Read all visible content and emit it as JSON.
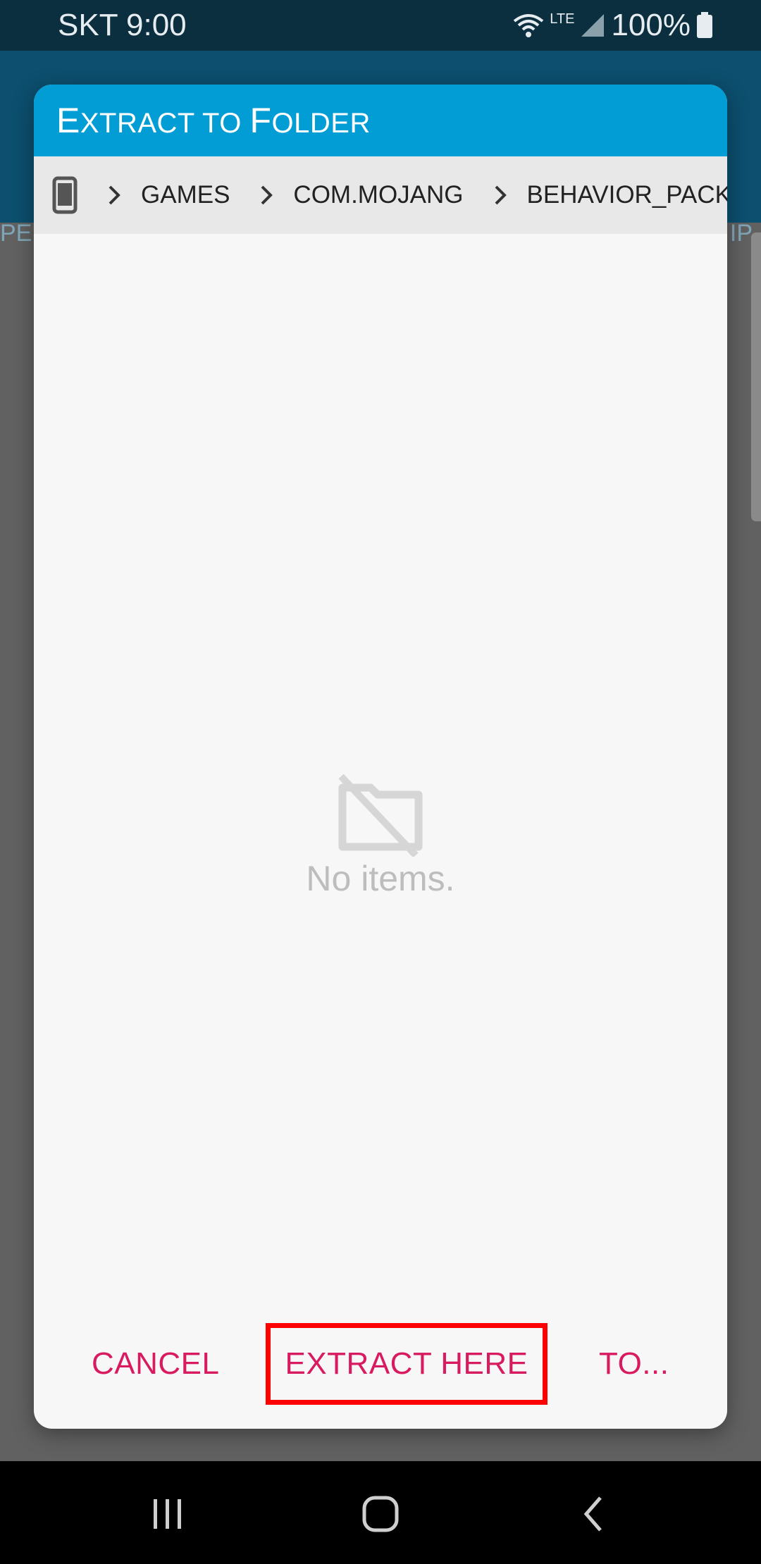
{
  "status_bar": {
    "carrier_time": "SKT 9:00",
    "network": "LTE",
    "battery": "100%"
  },
  "background_app": {
    "left_tab_fragment": "PE",
    "right_tab_fragment": "IP"
  },
  "dialog": {
    "title_parts": [
      "E",
      "XTRACT TO ",
      "F",
      "OLDER"
    ],
    "breadcrumb": [
      "GAMES",
      "COM.MOJANG",
      "BEHAVIOR_PACKS"
    ],
    "empty_message": "No items.",
    "buttons": {
      "cancel": "CANCEL",
      "extract_here": "EXTRACT HERE",
      "to": "TO..."
    }
  },
  "colors": {
    "header": "#039dd6",
    "accent": "#d81b60",
    "highlight_box": "#ff0000"
  },
  "icons": [
    "phone-storage-icon",
    "chevron-right-icon",
    "no-folder-icon",
    "recents-icon",
    "home-icon",
    "back-icon"
  ]
}
